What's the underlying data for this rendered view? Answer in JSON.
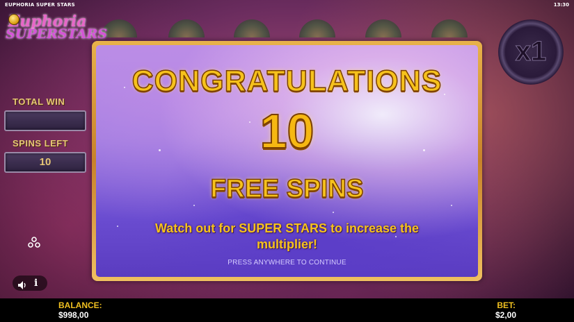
{
  "topbar": {
    "game_title": "EUPHORIA SUPER STARS",
    "clock": "13:30"
  },
  "logo": {
    "line1": "Euphoria",
    "line2": "SUPERSTARS"
  },
  "side_panel": {
    "total_win_label": "TOTAL WIN",
    "total_win_value": "",
    "spins_left_label": "SPINS LEFT",
    "spins_left_value": "10"
  },
  "multiplier": {
    "label": "x1"
  },
  "dialog": {
    "title": "CONGRATULATIONS",
    "count": "10",
    "subtitle": "FREE SPINS",
    "message": "Watch out for SUPER STARS to  increase the multiplier!",
    "continue_text": "PRESS ANYWHERE TO CONTINUE"
  },
  "controls": {
    "sound_icon": "speaker-icon",
    "info_icon": "info-icon",
    "settings_icon": "gear-icon",
    "info_label": "i"
  },
  "bottombar": {
    "balance_label": "BALANCE:",
    "balance_value": "$998,00",
    "bet_label": "BET:",
    "bet_value": "$2,00"
  },
  "colors": {
    "gold": "#f6c21c",
    "bar_bg": "#000000",
    "label_gold": "#f0c020"
  }
}
